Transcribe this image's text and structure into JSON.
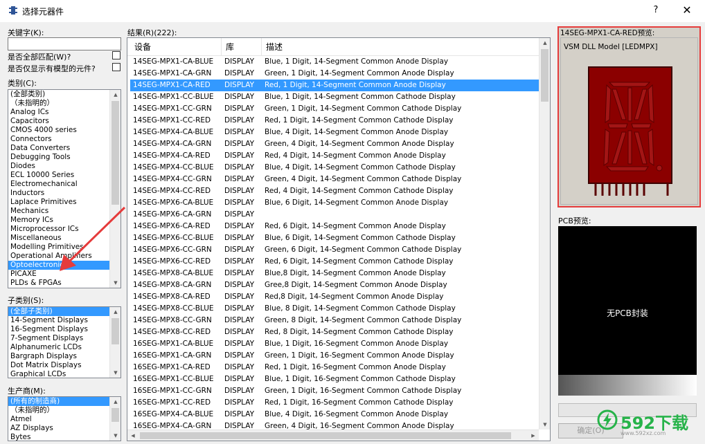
{
  "window": {
    "title": "选择元器件",
    "help_label": "?",
    "close_label": "✕",
    "app_icon": "component-pin-icon"
  },
  "left_panel": {
    "keyword_label": "关键字(K):",
    "keyword_value": "",
    "match_whole_label": "是否全部匹配(W)?",
    "models_only_label": "是否仅显示有模型的元件?",
    "category_label": "类别(C):",
    "categories": [
      "(全部类别)",
      "（未指明的）",
      "Analog ICs",
      "Capacitors",
      "CMOS 4000 series",
      "Connectors",
      "Data Converters",
      "Debugging Tools",
      "Diodes",
      "ECL 10000 Series",
      "Electromechanical",
      "Inductors",
      "Laplace Primitives",
      "Mechanics",
      "Memory ICs",
      "Microprocessor ICs",
      "Miscellaneous",
      "Modelling Primitives",
      "Operational Amplifiers",
      "Optoelectronics",
      "PICAXE",
      "PLDs & FPGAs"
    ],
    "category_selected_index": 19,
    "subcategory_label": "子类别(S):",
    "subcategories": [
      "(全部子类别)",
      "14-Segment Displays",
      "16-Segment Displays",
      "7-Segment Displays",
      "Alphanumeric LCDs",
      "Bargraph Displays",
      "Dot Matrix Displays",
      "Graphical LCDs"
    ],
    "subcategory_selected_index": 0,
    "manufacturer_label": "生产商(M):",
    "manufacturers": [
      "(所有的制造商)",
      "（未指明的）",
      "Atmel",
      "AZ Displays",
      "Bytes"
    ],
    "manufacturer_selected_index": 0
  },
  "results": {
    "label": "结果(R)(222):",
    "columns": [
      "设备",
      "库",
      "描述"
    ],
    "selected_index": 2,
    "rows": [
      [
        "14SEG-MPX1-CA-BLUE",
        "DISPLAY",
        "Blue, 1 Digit, 14-Segment Common Anode Display"
      ],
      [
        "14SEG-MPX1-CA-GRN",
        "DISPLAY",
        "Green, 1 Digit, 14-Segment Common Anode Display"
      ],
      [
        "14SEG-MPX1-CA-RED",
        "DISPLAY",
        "Red, 1 Digit, 14-Segment Common Anode Display"
      ],
      [
        "14SEG-MPX1-CC-BLUE",
        "DISPLAY",
        "Blue, 1 Digit, 14-Segment Common Cathode Display"
      ],
      [
        "14SEG-MPX1-CC-GRN",
        "DISPLAY",
        "Green, 1 Digit, 14-Segment Common Cathode Display"
      ],
      [
        "14SEG-MPX1-CC-RED",
        "DISPLAY",
        "Red, 1 Digit, 14-Segment Common Cathode Display"
      ],
      [
        "14SEG-MPX4-CA-BLUE",
        "DISPLAY",
        "Blue, 4 Digit, 14-Segment Common Anode Display"
      ],
      [
        "14SEG-MPX4-CA-GRN",
        "DISPLAY",
        "Green, 4 Digit, 14-Segment Common Anode Display"
      ],
      [
        "14SEG-MPX4-CA-RED",
        "DISPLAY",
        "Red, 4 Digit, 14-Segment Common Anode Display"
      ],
      [
        "14SEG-MPX4-CC-BLUE",
        "DISPLAY",
        "Blue, 4 Digit, 14-Segment Common Cathode Display"
      ],
      [
        "14SEG-MPX4-CC-GRN",
        "DISPLAY",
        "Green, 4 Digit, 14-Segment Common Cathode Display"
      ],
      [
        "14SEG-MPX4-CC-RED",
        "DISPLAY",
        "Red, 4 Digit, 14-Segment Common Cathode Display"
      ],
      [
        "14SEG-MPX6-CA-BLUE",
        "DISPLAY",
        "Blue, 6 Digit, 14-Segment Common Anode Display"
      ],
      [
        "14SEG-MPX6-CA-GRN",
        "DISPLAY",
        ""
      ],
      [
        "14SEG-MPX6-CA-RED",
        "DISPLAY",
        "Red, 6 Digit, 14-Segment Common Anode Display"
      ],
      [
        "14SEG-MPX6-CC-BLUE",
        "DISPLAY",
        "Blue, 6 Digit, 14-Segment Common Cathode Display"
      ],
      [
        "14SEG-MPX6-CC-GRN",
        "DISPLAY",
        "Green, 6 Digit, 14-Segment Common Cathode Display"
      ],
      [
        "14SEG-MPX6-CC-RED",
        "DISPLAY",
        "Red, 6 Digit, 14-Segment Common Cathode Display"
      ],
      [
        "14SEG-MPX8-CA-BLUE",
        "DISPLAY",
        "Blue,8 Digit, 14-Segment Common Anode Display"
      ],
      [
        "14SEG-MPX8-CA-GRN",
        "DISPLAY",
        "Gree,8 Digit, 14-Segment Common Anode Display"
      ],
      [
        "14SEG-MPX8-CA-RED",
        "DISPLAY",
        "Red,8 Digit, 14-Segment Common Anode Display"
      ],
      [
        "14SEG-MPX8-CC-BLUE",
        "DISPLAY",
        "Blue, 8 Digit, 14-Segment Common Cathode Display"
      ],
      [
        "14SEG-MPX8-CC-GRN",
        "DISPLAY",
        "Green, 8 Digit, 14-Segment Common Cathode Display"
      ],
      [
        "14SEG-MPX8-CC-RED",
        "DISPLAY",
        "Red, 8 Digit, 14-Segment Common Cathode Display"
      ],
      [
        "16SEG-MPX1-CA-BLUE",
        "DISPLAY",
        "Blue, 1 Digit, 16-Segment Common Anode Display"
      ],
      [
        "16SEG-MPX1-CA-GRN",
        "DISPLAY",
        "Green, 1 Digit, 16-Segment Common Anode Display"
      ],
      [
        "16SEG-MPX1-CA-RED",
        "DISPLAY",
        "Red, 1 Digit, 16-Segment Common Anode Display"
      ],
      [
        "16SEG-MPX1-CC-BLUE",
        "DISPLAY",
        "Blue, 1 Digit, 16-Segment Common Cathode Display"
      ],
      [
        "16SEG-MPX1-CC-GRN",
        "DISPLAY",
        "Green, 1 Digit, 16-Segment Common Cathode Display"
      ],
      [
        "16SEG-MPX1-CC-RED",
        "DISPLAY",
        "Red, 1 Digit, 16-Segment Common Cathode Display"
      ],
      [
        "16SEG-MPX4-CA-BLUE",
        "DISPLAY",
        "Blue, 4 Digit, 16-Segment Common Anode Display"
      ],
      [
        "16SEG-MPX4-CA-GRN",
        "DISPLAY",
        "Green, 4 Digit, 16-Segment Common Anode Display"
      ]
    ]
  },
  "preview": {
    "label": "14SEG-MPX1-CA-RED预览:",
    "model_text": "VSM DLL Model [LEDMPX]",
    "frame_color": "#e53b3b",
    "body_color": "#8b0000"
  },
  "pcb": {
    "label": "PCB预览:",
    "message": "无PCB封装"
  },
  "buttons": {
    "ok_label": "确定(O)"
  },
  "watermark": {
    "brand": "592下载",
    "url": "www.592xz.com",
    "color": "#27b34a"
  }
}
